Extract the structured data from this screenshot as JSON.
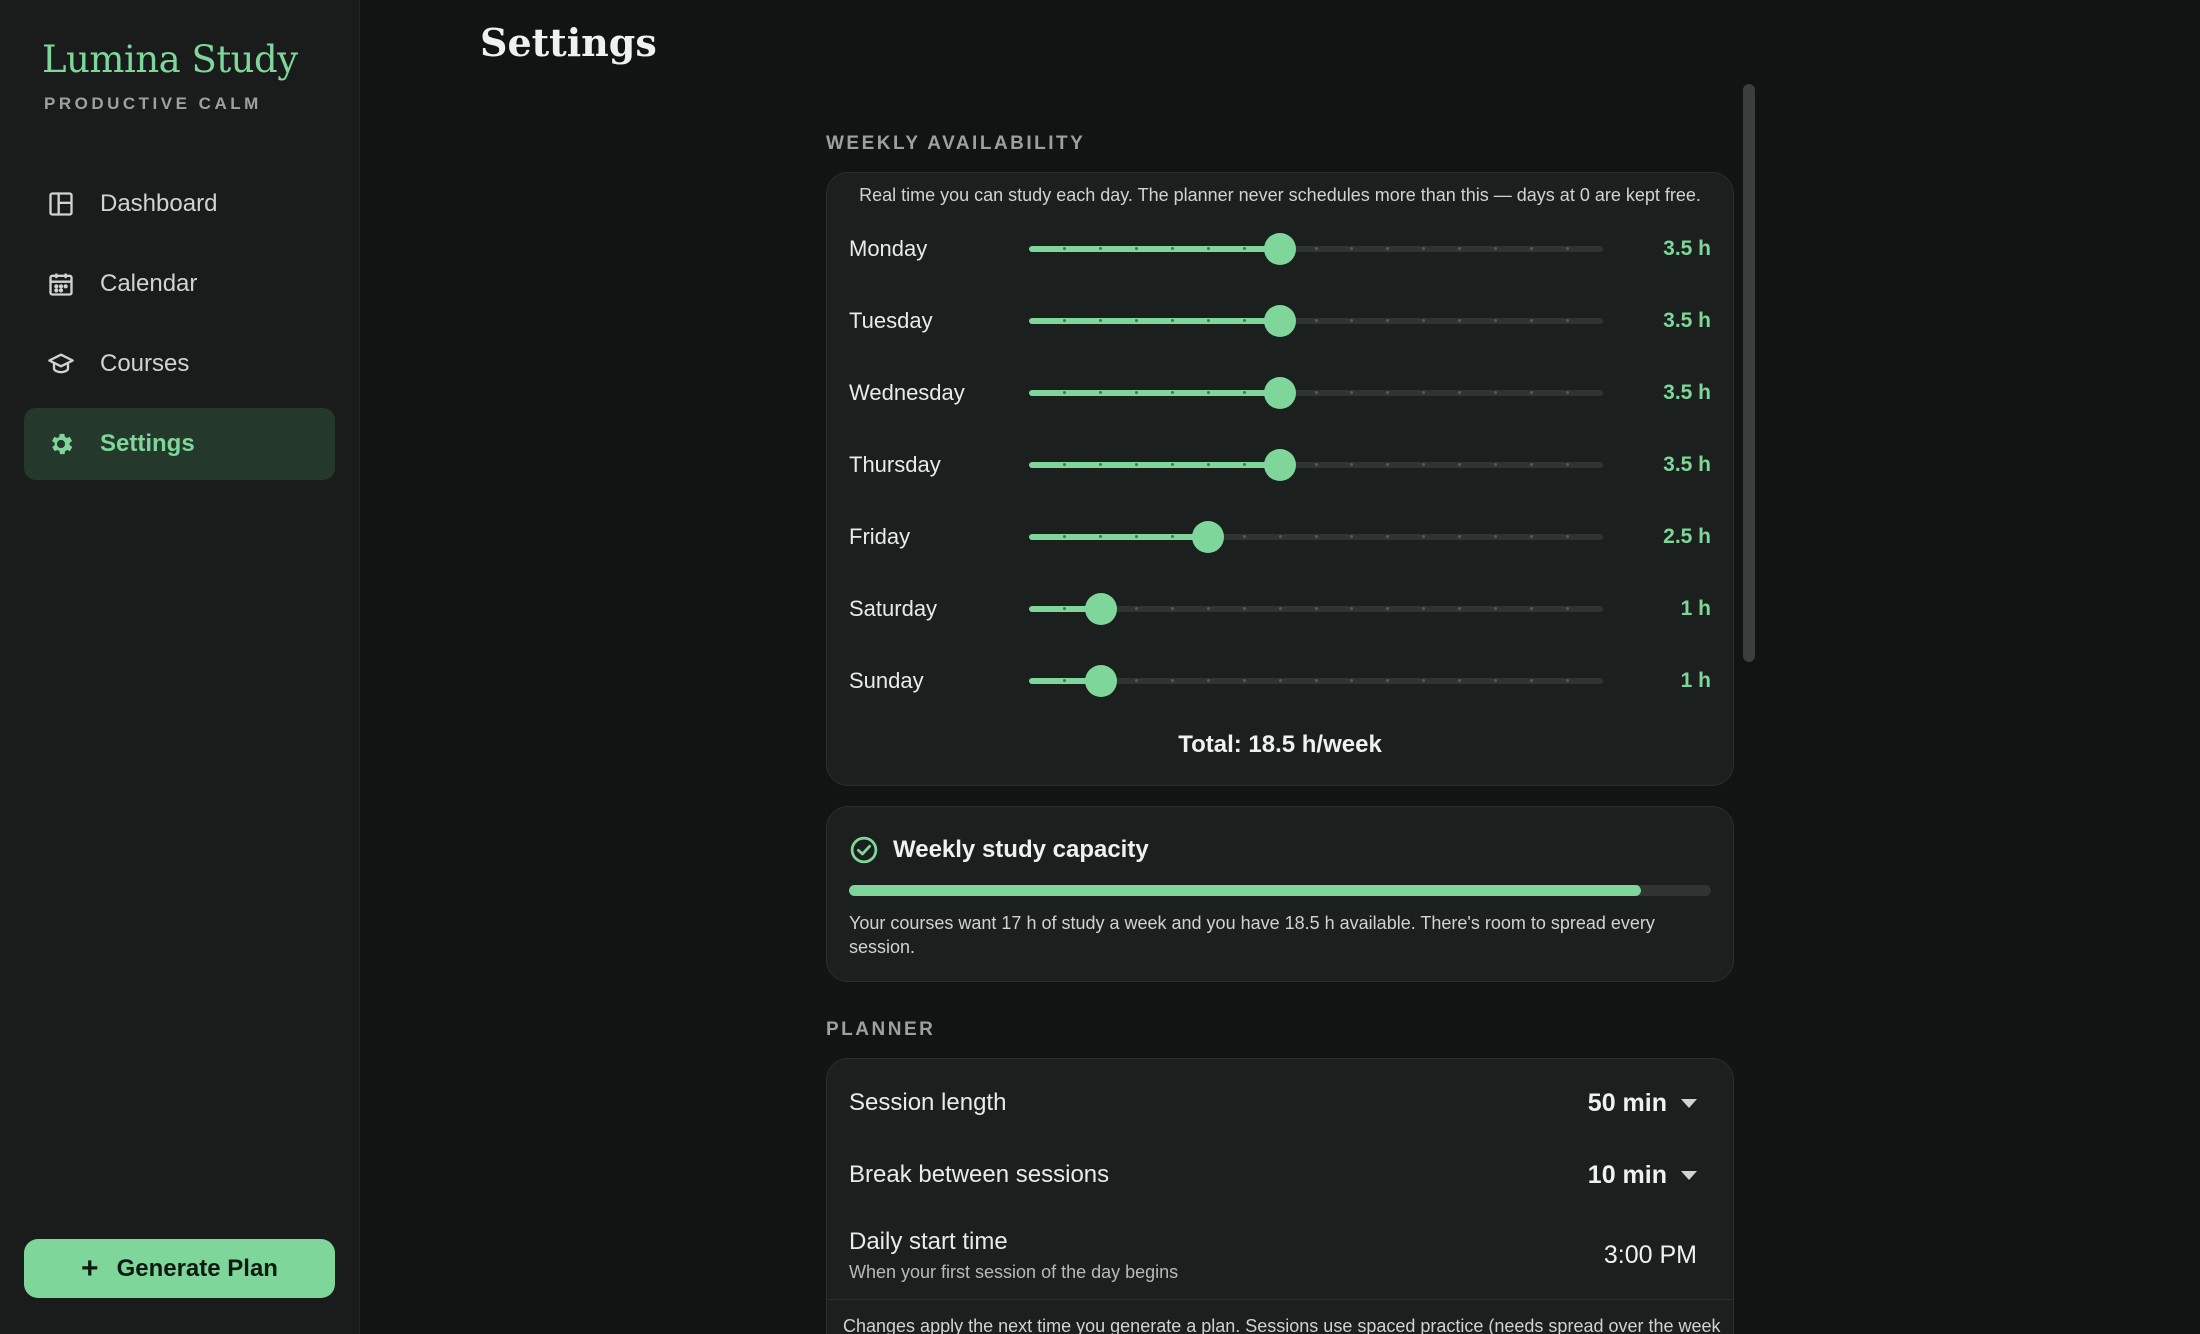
{
  "app": {
    "name": "Lumina Study",
    "tagline": "PRODUCTIVE CALM"
  },
  "sidebar": {
    "items": [
      {
        "label": "Dashboard",
        "icon": "dashboard-icon",
        "active": false
      },
      {
        "label": "Calendar",
        "icon": "calendar-icon",
        "active": false
      },
      {
        "label": "Courses",
        "icon": "graduation-cap-icon",
        "active": false
      },
      {
        "label": "Settings",
        "icon": "gear-icon",
        "active": true
      }
    ],
    "generate_label": "Generate Plan"
  },
  "page": {
    "title": "Settings"
  },
  "availability": {
    "section_label": "WEEKLY AVAILABILITY",
    "note": "Real time you can study each day. The planner never schedules more than this — days at 0 are kept free.",
    "max_hours": 8,
    "step_hours": 0.5,
    "days": [
      {
        "name": "Monday",
        "hours": 3.5,
        "value_label": "3.5 h"
      },
      {
        "name": "Tuesday",
        "hours": 3.5,
        "value_label": "3.5 h"
      },
      {
        "name": "Wednesday",
        "hours": 3.5,
        "value_label": "3.5 h"
      },
      {
        "name": "Thursday",
        "hours": 3.5,
        "value_label": "3.5 h"
      },
      {
        "name": "Friday",
        "hours": 2.5,
        "value_label": "2.5 h"
      },
      {
        "name": "Saturday",
        "hours": 1,
        "value_label": "1 h"
      },
      {
        "name": "Sunday",
        "hours": 1,
        "value_label": "1 h"
      }
    ],
    "total_label": "Total: 18.5 h/week"
  },
  "capacity": {
    "title": "Weekly study capacity",
    "icon": "check-circle-icon",
    "fill_fraction": 0.919,
    "message": "Your courses want 17 h of study a week and you have 18.5 h available. There's room to spread every session."
  },
  "planner": {
    "section_label": "PLANNER",
    "session_length": {
      "label": "Session length",
      "value": "50 min"
    },
    "break_between": {
      "label": "Break between sessions",
      "value": "10 min"
    },
    "daily_start": {
      "label": "Daily start time",
      "sub": "When your first session of the day begins",
      "value": "3:00 PM"
    },
    "footer": "Changes apply the next time you generate a plan. Sessions use spaced practice (needs spread over the week"
  },
  "colors": {
    "accent": "#7fd69a",
    "background": "#111413",
    "sidebar": "#191c1b",
    "card": "#1b1f1d"
  }
}
